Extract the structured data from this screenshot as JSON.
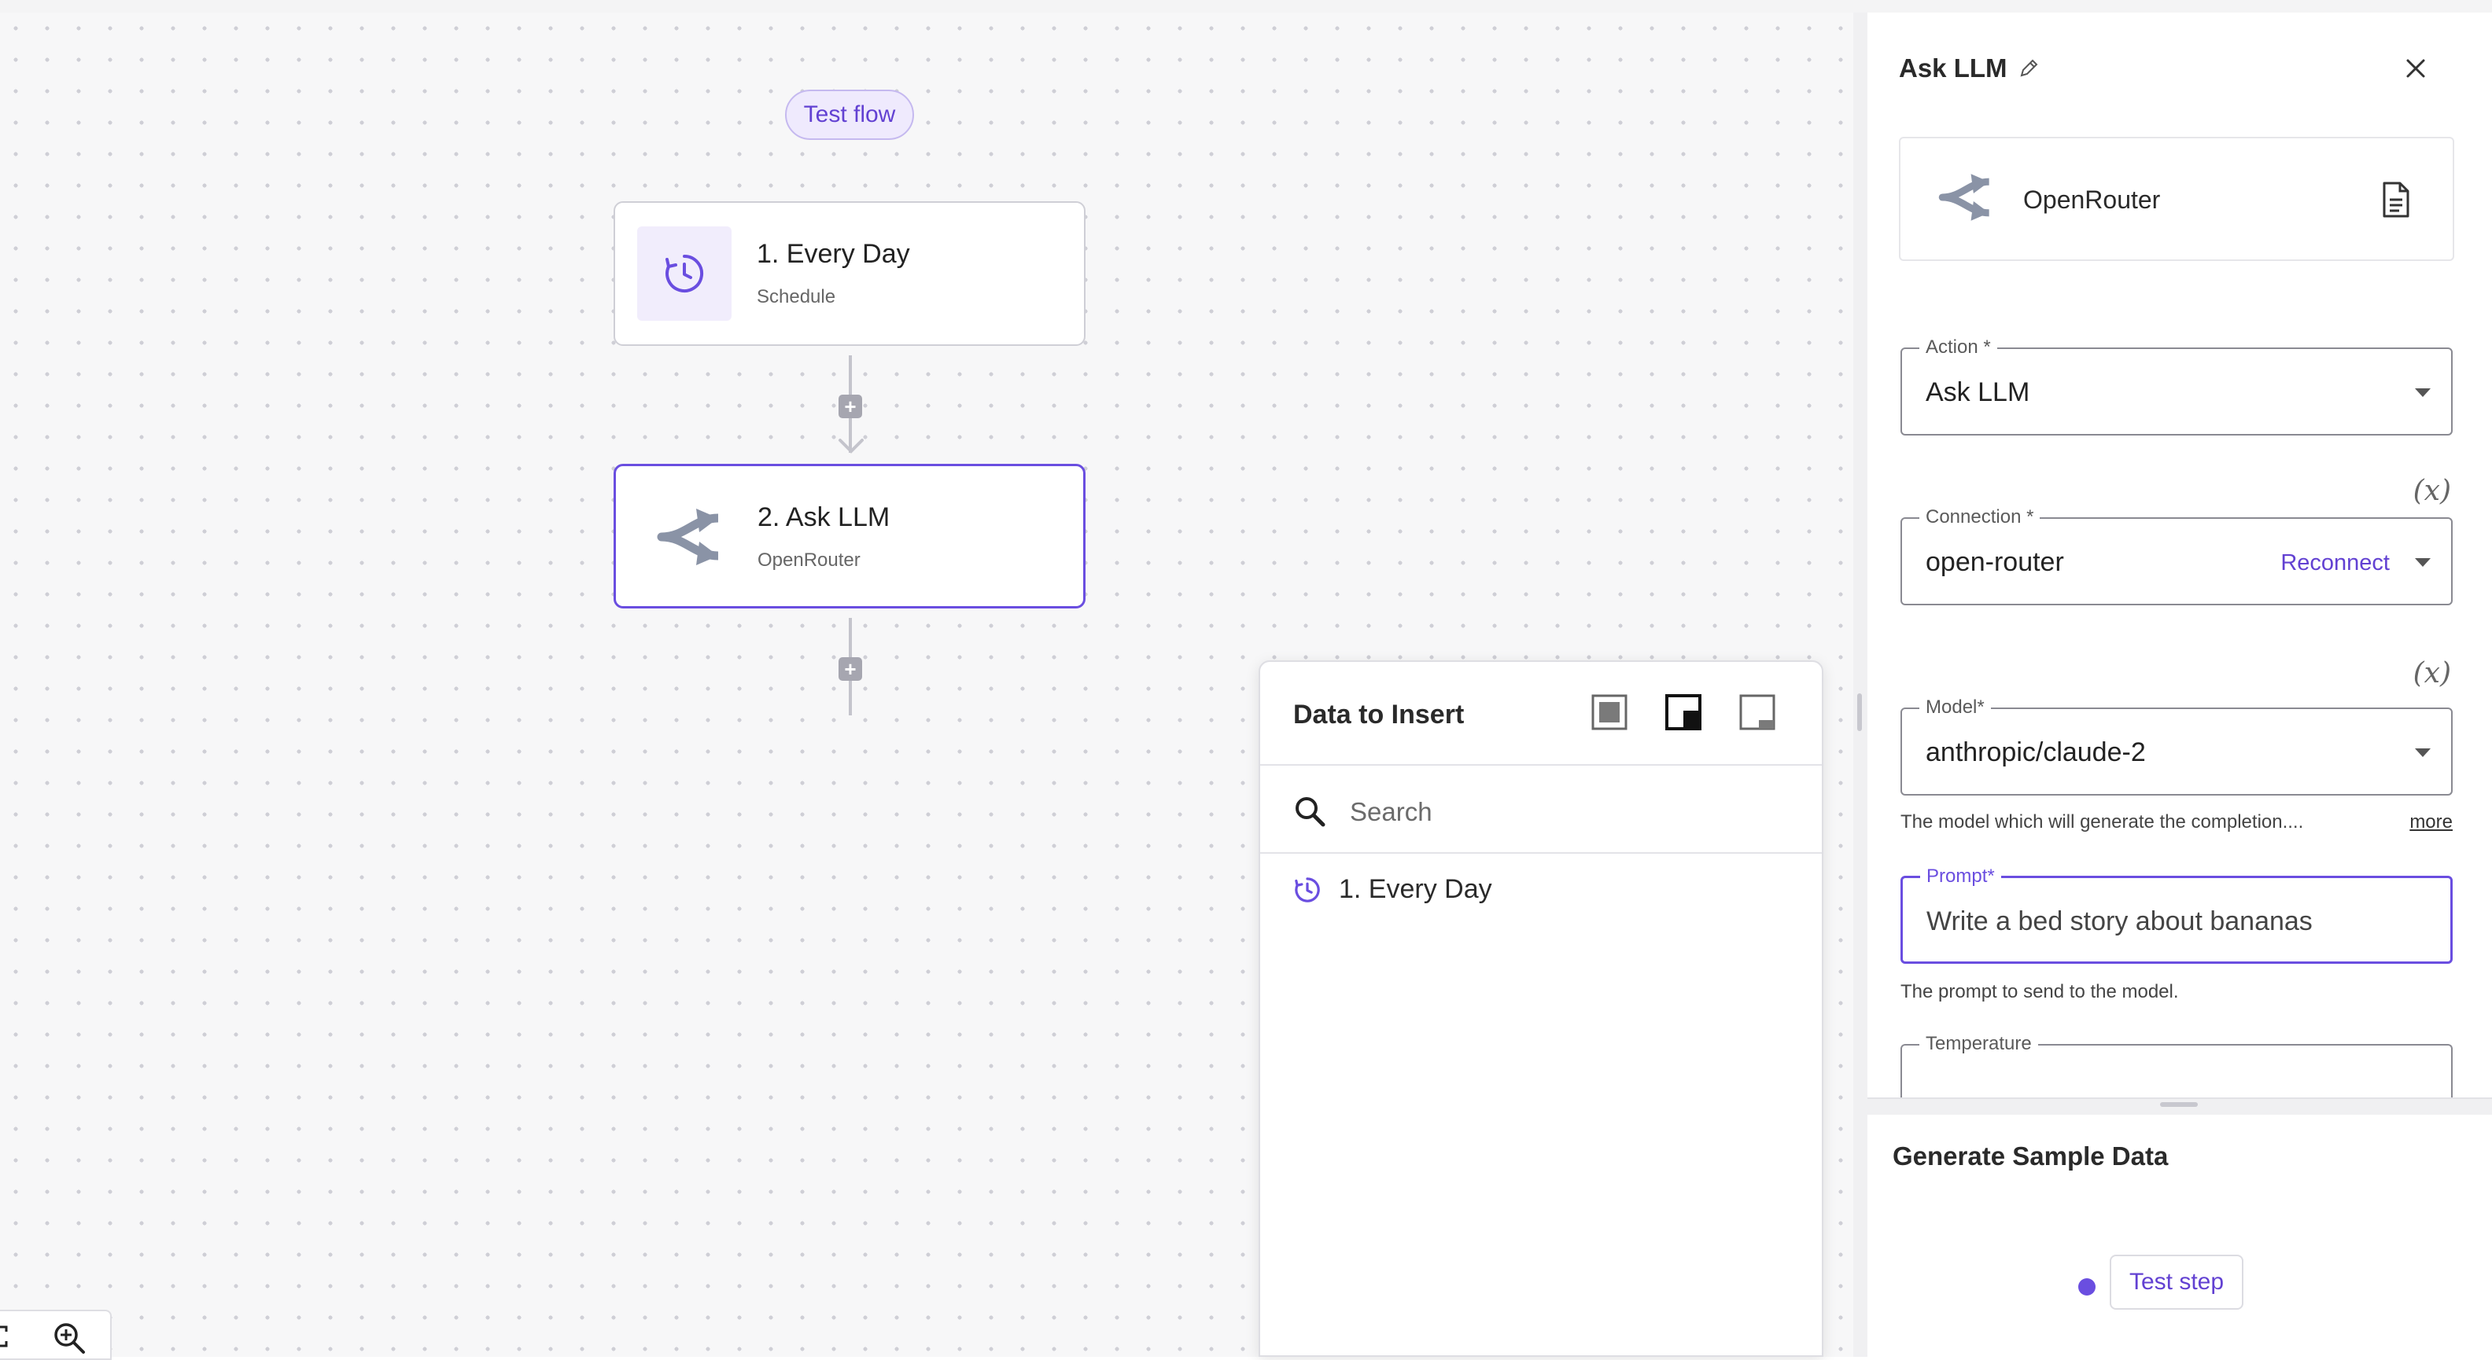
{
  "canvas": {
    "test_flow_label": "Test flow",
    "nodes": [
      {
        "title": "1. Every Day",
        "subtitle": "Schedule",
        "icon": "clock-icon"
      },
      {
        "title": "2. Ask LLM",
        "subtitle": "OpenRouter",
        "icon": "openrouter-icon"
      }
    ],
    "add_step_symbol": "+",
    "zoom_controls": {
      "fit_icon": "fit-view-icon",
      "zoom_in_icon": "zoom-in-icon"
    }
  },
  "data_to_insert": {
    "title": "Data to Insert",
    "view_mode_icons": [
      "docked-full-icon",
      "docked-side-icon",
      "docked-bottom-icon"
    ],
    "search_placeholder": "Search",
    "items": [
      {
        "label": "1. Every Day",
        "icon": "clock-icon"
      }
    ]
  },
  "panel": {
    "title": "Ask LLM",
    "edit_icon": "pencil-icon",
    "close_icon": "close-icon",
    "piece": {
      "name": "OpenRouter",
      "doc_icon": "document-icon"
    },
    "fields": {
      "action": {
        "label": "Action *",
        "value": "Ask LLM"
      },
      "connection": {
        "label": "Connection *",
        "value": "open-router",
        "reconnect_label": "Reconnect"
      },
      "model": {
        "label": "Model*",
        "value": "anthropic/claude-2",
        "help": "The model which will generate the completion....",
        "more_label": "more"
      },
      "prompt": {
        "label": "Prompt*",
        "value": "Write a bed story about bananas",
        "help": "The prompt to send to the model."
      },
      "temperature": {
        "label": "Temperature",
        "value": ""
      }
    },
    "variable_toggle_label": "(x)",
    "sample_data": {
      "title": "Generate Sample Data",
      "test_step_label": "Test step"
    }
  },
  "colors": {
    "accent": "#6a4ee0",
    "accent_text": "#6241d2",
    "accent_bg": "#efeafd"
  }
}
